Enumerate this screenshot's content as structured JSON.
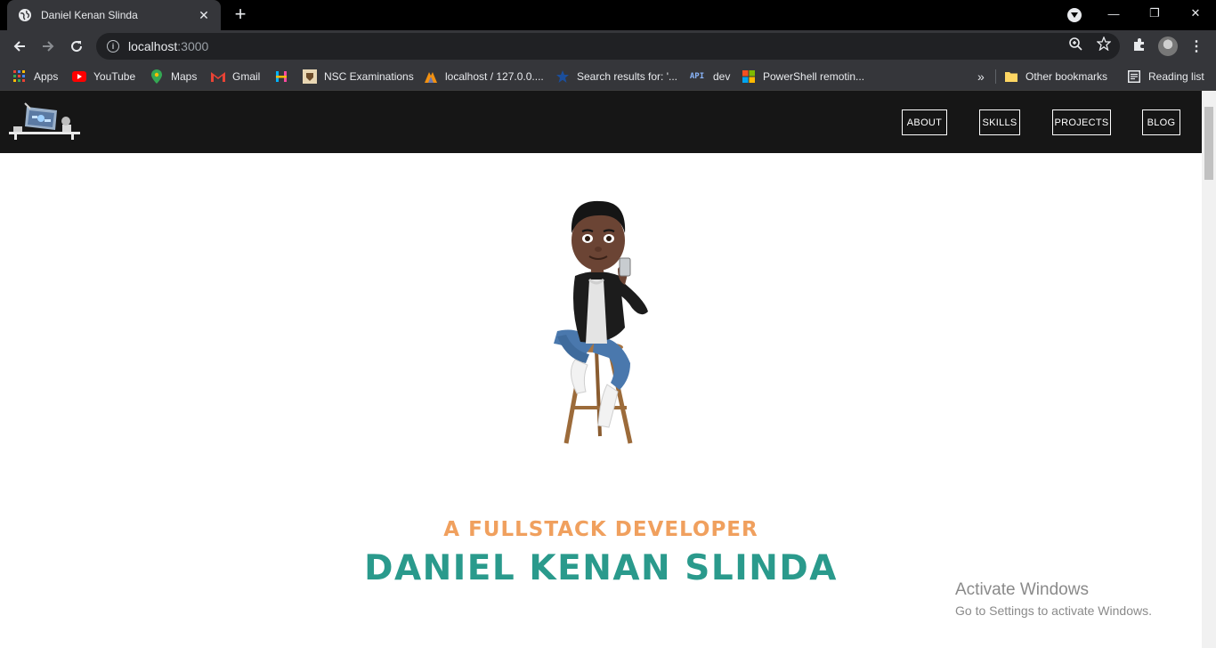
{
  "browser": {
    "tab": {
      "title": "Daniel Kenan Slinda",
      "favicon": "globe-icon"
    },
    "url": {
      "host": "localhost",
      "port": ":3000"
    },
    "bookmarks": [
      {
        "label": "Apps",
        "icon": "apps-grid-icon"
      },
      {
        "label": "YouTube",
        "icon": "youtube-icon"
      },
      {
        "label": "Maps",
        "icon": "maps-pin-icon"
      },
      {
        "label": "Gmail",
        "icon": "gmail-icon"
      },
      {
        "label": "",
        "icon": "h-logo-icon"
      },
      {
        "label": "NSC Examinations",
        "icon": "crest-icon"
      },
      {
        "label": "localhost / 127.0.0....",
        "icon": "phpmyadmin-icon"
      },
      {
        "label": "Search results for: '...",
        "icon": "star-icon"
      },
      {
        "label": "dev",
        "icon": "api-icon"
      },
      {
        "label": "PowerShell remotin...",
        "icon": "microsoft-icon"
      }
    ],
    "other_bookmarks": "Other bookmarks",
    "reading_list": "Reading list"
  },
  "site": {
    "nav": [
      "ABOUT",
      "SKILLS",
      "PROJECTS",
      "BLOG"
    ],
    "hero": {
      "subtitle": "A FULLSTACK DEVELOPER",
      "name": "DANIEL KENAN SLINDA"
    }
  },
  "os_overlay": {
    "line1": "Activate Windows",
    "line2": "Go to Settings to activate Windows."
  },
  "colors": {
    "subtitle": "#f0a05e",
    "name": "#2a9a8c",
    "site_nav_bg": "#161616"
  }
}
